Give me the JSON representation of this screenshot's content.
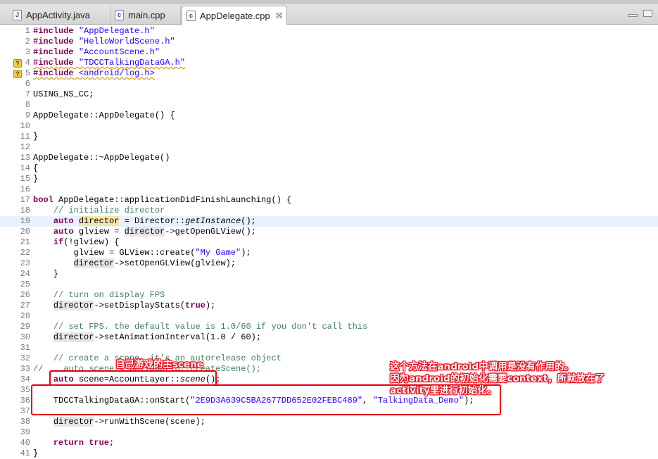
{
  "tabs": [
    {
      "label": "AppActivity.java",
      "icon": "java-file-icon",
      "glyph": "J"
    },
    {
      "label": "main.cpp",
      "icon": "cpp-file-icon",
      "glyph": "c"
    },
    {
      "label": "AppDelegate.cpp",
      "icon": "cpp-file-icon",
      "glyph": "c",
      "active": true,
      "close": "☒"
    }
  ],
  "editor": {
    "markers": [
      {
        "line": 4,
        "glyph": "?"
      },
      {
        "line": 5,
        "glyph": "?"
      }
    ],
    "highlighted_line": 19,
    "lines": [
      {
        "n": "1",
        "segs": [
          [
            "pp",
            "#include"
          ],
          [
            "",
            " "
          ],
          [
            "str",
            "\"AppDelegate.h\""
          ]
        ]
      },
      {
        "n": "2",
        "segs": [
          [
            "pp",
            "#include"
          ],
          [
            "",
            " "
          ],
          [
            "str",
            "\"HelloWorldScene.h\""
          ]
        ]
      },
      {
        "n": "3",
        "segs": [
          [
            "pp",
            "#include"
          ],
          [
            "",
            " "
          ],
          [
            "str",
            "\"AccountScene.h\""
          ]
        ]
      },
      {
        "n": "4",
        "segs": [
          [
            "pp squig",
            "#include"
          ],
          [
            "squig",
            " "
          ],
          [
            "str squig",
            "\"TDCCTalkingDataGA.h\""
          ]
        ]
      },
      {
        "n": "5",
        "segs": [
          [
            "pp squig",
            "#include"
          ],
          [
            "squig",
            " "
          ],
          [
            "str squig",
            "<android/log.h>"
          ]
        ]
      },
      {
        "n": "6",
        "segs": []
      },
      {
        "n": "7",
        "segs": [
          [
            "",
            "USING_NS_CC;"
          ]
        ]
      },
      {
        "n": "8",
        "segs": []
      },
      {
        "n": "9",
        "segs": [
          [
            "",
            "AppDelegate::AppDelegate() {"
          ]
        ]
      },
      {
        "n": "10",
        "segs": []
      },
      {
        "n": "11",
        "segs": [
          [
            "",
            "}"
          ]
        ]
      },
      {
        "n": "12",
        "segs": []
      },
      {
        "n": "13",
        "segs": [
          [
            "",
            "AppDelegate::~AppDelegate()"
          ]
        ]
      },
      {
        "n": "14",
        "segs": [
          [
            "",
            "{"
          ]
        ]
      },
      {
        "n": "15",
        "segs": [
          [
            "",
            "}"
          ]
        ]
      },
      {
        "n": "16",
        "segs": []
      },
      {
        "n": "17",
        "segs": [
          [
            "kw",
            "bool"
          ],
          [
            "",
            " AppDelegate::applicationDidFinishLaunching() {"
          ]
        ]
      },
      {
        "n": "18",
        "segs": [
          [
            "",
            "    "
          ],
          [
            "cm",
            "// initialize director"
          ]
        ]
      },
      {
        "n": "19",
        "segs": [
          [
            "",
            "    "
          ],
          [
            "kw",
            "auto"
          ],
          [
            "",
            " "
          ],
          [
            "var sel",
            "director"
          ],
          [
            "",
            " = Director::"
          ],
          [
            "it",
            "getInstance"
          ],
          [
            "",
            "();"
          ]
        ]
      },
      {
        "n": "20",
        "segs": [
          [
            "",
            "    "
          ],
          [
            "kw",
            "auto"
          ],
          [
            "",
            " glview = "
          ],
          [
            "var",
            "director"
          ],
          [
            "",
            "->getOpenGLView();"
          ]
        ]
      },
      {
        "n": "21",
        "segs": [
          [
            "",
            "    "
          ],
          [
            "kw",
            "if"
          ],
          [
            "",
            "(!glview) {"
          ]
        ]
      },
      {
        "n": "22",
        "segs": [
          [
            "",
            "        glview = GLView::create("
          ],
          [
            "str",
            "\"My Game\""
          ],
          [
            "",
            ");"
          ]
        ]
      },
      {
        "n": "23",
        "segs": [
          [
            "",
            "        "
          ],
          [
            "var",
            "director"
          ],
          [
            "",
            "->setOpenGLView(glview);"
          ]
        ]
      },
      {
        "n": "24",
        "segs": [
          [
            "",
            "    }"
          ]
        ]
      },
      {
        "n": "25",
        "segs": []
      },
      {
        "n": "26",
        "segs": [
          [
            "",
            "    "
          ],
          [
            "cm",
            "// turn on display FPS"
          ]
        ]
      },
      {
        "n": "27",
        "segs": [
          [
            "",
            "    "
          ],
          [
            "var",
            "director"
          ],
          [
            "",
            "->setDisplayStats("
          ],
          [
            "kw",
            "true"
          ],
          [
            "",
            ");"
          ]
        ]
      },
      {
        "n": "28",
        "segs": []
      },
      {
        "n": "29",
        "segs": [
          [
            "",
            "    "
          ],
          [
            "cm",
            "// set FPS. the default value is 1.0/60 if you don't call this"
          ]
        ]
      },
      {
        "n": "30",
        "segs": [
          [
            "",
            "    "
          ],
          [
            "var",
            "director"
          ],
          [
            "",
            "->setAnimationInterval(1.0 / 60);"
          ]
        ]
      },
      {
        "n": "31",
        "segs": []
      },
      {
        "n": "32",
        "segs": [
          [
            "",
            "    "
          ],
          [
            "cm",
            "// create a scene. it's an autorelease object"
          ]
        ]
      },
      {
        "n": "33",
        "segs": [
          [
            "cm",
            "//    auto scene = HelloWorld::createScene();"
          ]
        ]
      },
      {
        "n": "34",
        "segs": [
          [
            "",
            "    "
          ],
          [
            "kw",
            "auto"
          ],
          [
            "",
            " scene=AccountLayer::"
          ],
          [
            "it",
            "scene"
          ],
          [
            "",
            "();"
          ]
        ]
      },
      {
        "n": "35",
        "segs": []
      },
      {
        "n": "36",
        "segs": [
          [
            "",
            "    TDCCTalkingDataGA::onStart("
          ],
          [
            "str",
            "\"2E9D3A639C5BA2677DD652E02FEBC489\""
          ],
          [
            "",
            ", "
          ],
          [
            "str",
            "\"TalkingData_Demo\""
          ],
          [
            "",
            ");"
          ]
        ]
      },
      {
        "n": "37",
        "segs": []
      },
      {
        "n": "38",
        "segs": [
          [
            "",
            "    "
          ],
          [
            "var",
            "director"
          ],
          [
            "",
            "->runWithScene(scene);"
          ]
        ]
      },
      {
        "n": "39",
        "segs": []
      },
      {
        "n": "40",
        "segs": [
          [
            "",
            "    "
          ],
          [
            "kw",
            "return"
          ],
          [
            "",
            " "
          ],
          [
            "kw",
            "true"
          ],
          [
            "",
            ";"
          ]
        ]
      },
      {
        "n": "41",
        "segs": [
          [
            "",
            "}"
          ]
        ]
      }
    ]
  },
  "annotations": {
    "scene_note": "自己游戏的主scene",
    "context_note_lines": [
      "这个方法在android中调用是没有作用的。",
      "因为android的初始化需要context，所就放在了",
      "activity里进行初始化。"
    ],
    "color": "#e60012"
  }
}
